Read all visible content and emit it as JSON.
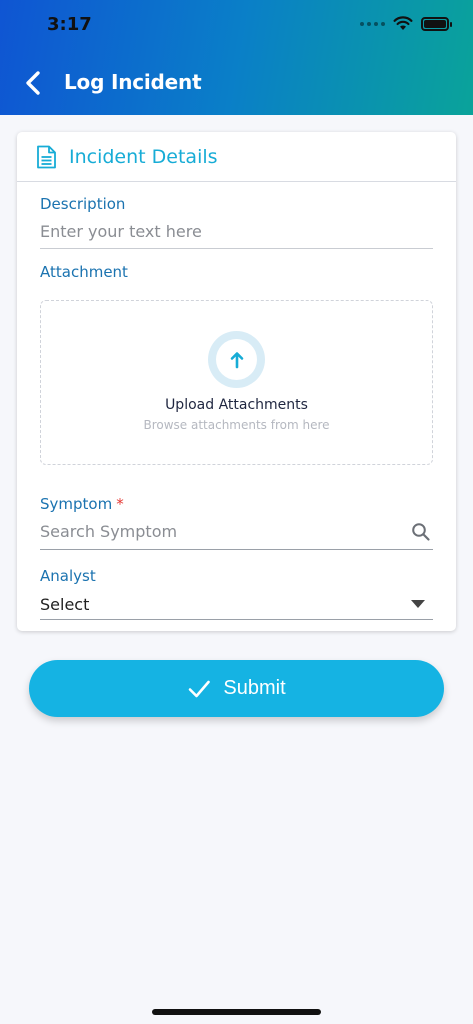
{
  "status_bar": {
    "time": "3:17"
  },
  "header": {
    "title": "Log Incident",
    "back_icon": "chevron-left-icon"
  },
  "card": {
    "title": "Incident Details",
    "icon": "document-icon",
    "description": {
      "label": "Description",
      "placeholder": "Enter your text here"
    },
    "attachment": {
      "label": "Attachment",
      "upload_title": "Upload Attachments",
      "upload_subtitle": "Browse attachments from here",
      "icon": "upload-arrow-icon"
    },
    "symptom": {
      "label": "Symptom",
      "required_mark": "*",
      "placeholder": "Search Symptom",
      "icon": "search-icon"
    },
    "analyst": {
      "label": "Analyst",
      "value": "Select",
      "icon": "dropdown-arrow-icon"
    }
  },
  "submit": {
    "label": "Submit",
    "icon": "check-icon"
  },
  "colors": {
    "accent": "#17acd6",
    "label": "#1b73b0",
    "button": "#15b3e3",
    "required": "#e53935"
  }
}
